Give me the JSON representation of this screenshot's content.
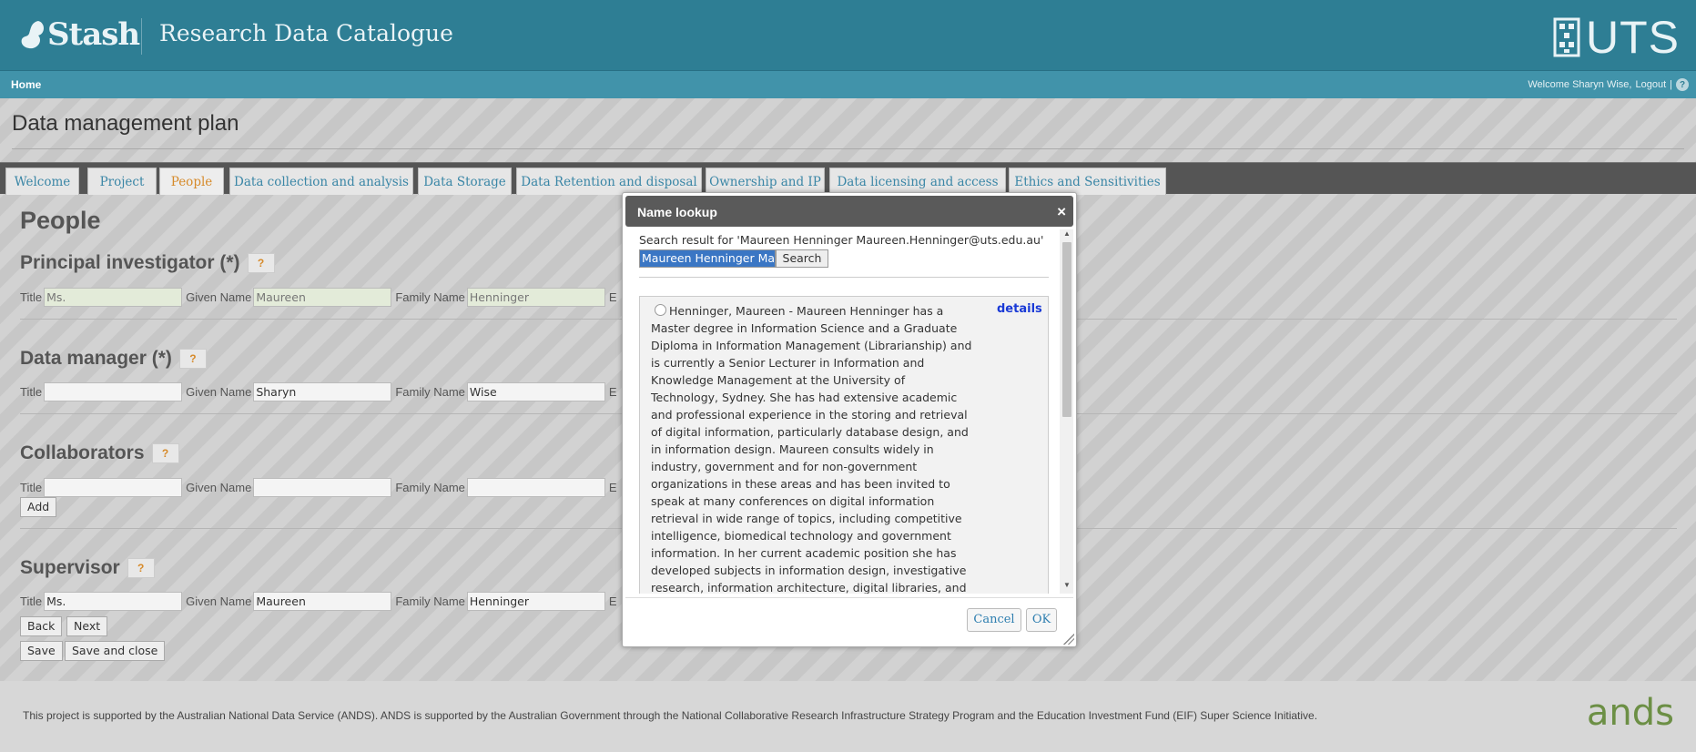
{
  "header": {
    "logo_text": "Stash",
    "site_title": "Research Data Catalogue",
    "uts_logo": "UTS"
  },
  "nav": {
    "home": "Home",
    "welcome": "Welcome Sharyn Wise,",
    "logout": "Logout",
    "pipe": "|",
    "help": "?"
  },
  "page_title": "Data management plan",
  "tabs": [
    {
      "label": "Welcome"
    },
    {
      "label": "Project"
    },
    {
      "label": "People"
    },
    {
      "label": "Data collection and analysis"
    },
    {
      "label": "Data Storage"
    },
    {
      "label": "Data Retention and disposal"
    },
    {
      "label": "Ownership and IP"
    },
    {
      "label": "Data licensing and access"
    },
    {
      "label": "Ethics and Sensitivities"
    }
  ],
  "active_tab": "People",
  "form": {
    "heading": "People",
    "help_label": "?",
    "labels": {
      "title": "Title",
      "given": "Given Name",
      "family": "Family Name",
      "email_prefix": "E"
    },
    "principal": {
      "heading": "Principal investigator (*)",
      "title": "Ms.",
      "given": "Maureen",
      "family": "Henninger"
    },
    "data_manager": {
      "heading": "Data manager (*)",
      "title": "",
      "given": "Sharyn",
      "family": "Wise"
    },
    "collaborators": {
      "heading": "Collaborators",
      "title": "",
      "given": "",
      "family": "",
      "add_label": "Add"
    },
    "supervisor": {
      "heading": "Supervisor",
      "title": "Ms.",
      "given": "Maureen",
      "family": "Henninger"
    },
    "buttons": {
      "back": "Back",
      "next": "Next",
      "save": "Save",
      "save_close": "Save and close"
    }
  },
  "dialog": {
    "title": "Name lookup",
    "close": "×",
    "search_result_label": "Search result for 'Maureen Henninger Maureen.Henninger@uts.edu.au'",
    "search_value": "Maureen Henninger Maureen.Henninger@uts.edu.au",
    "search_button": "Search",
    "result_text": "Henninger, Maureen - Maureen Henninger has a Master degree in Information Science and a Graduate Diploma in Information Management (Librarianship) and is currently a Senior Lecturer in Information and Knowledge Management at the University of Technology, Sydney. She has had extensive academic and professional experience in the storing and retrieval of digital information, particularly database design, and in information design. Maureen consults widely in industry, government and for non-government organizations in these areas and has been invited to speak at many conferences on digital information retrieval in wide range of topics, including competitive intelligence, biomedical technology and government information. In her current academic position she has developed subjects in information design, investigative research, information architecture, digital libraries, and digital curation. She is the coordinator of the",
    "details_link": "details",
    "cancel": "Cancel",
    "ok": "OK"
  },
  "footer": {
    "text": "This project is supported by the Australian National Data Service (ANDS). ANDS is supported by the Australian Government through the National Collaborative Research Infrastructure Strategy Program and the Education Investment Fund (EIF) Super Science Initiative.",
    "ands_logo": "ands"
  },
  "colors": {
    "header_bg": "#2e7e94",
    "nav_bg": "#4193aa",
    "tab_active_text": "#d68a2a",
    "tab_text": "#3a86a6",
    "dialog_title_bg": "#5a5a5a",
    "selection": "#3a76c4",
    "link": "#1a3ad6"
  },
  "icons": [
    "squirrel-logo-icon",
    "uts-logo-icon",
    "help-icon",
    "close-icon",
    "radio-icon",
    "scroll-up-icon",
    "scroll-down-icon",
    "resize-grip-icon",
    "ands-logo-icon"
  ]
}
